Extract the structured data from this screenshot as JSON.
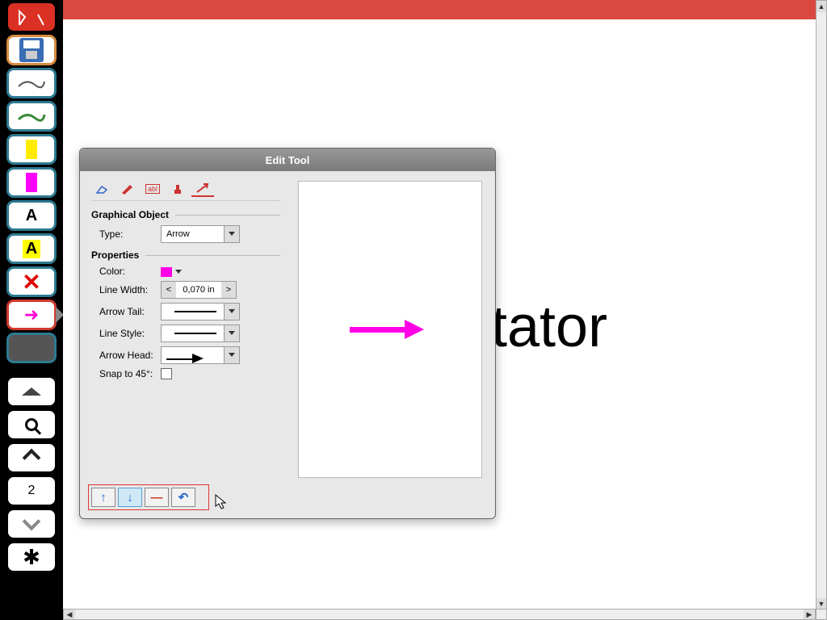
{
  "bg_text": "tator",
  "dialog": {
    "title": "Edit Tool",
    "section_object": "Graphical Object",
    "section_props": "Properties",
    "labels": {
      "type": "Type:",
      "color": "Color:",
      "line_width": "Line Width:",
      "arrow_tail": "Arrow Tail:",
      "line_style": "Line Style:",
      "arrow_head": "Arrow Head:",
      "snap": "Snap to 45°:"
    },
    "values": {
      "type": "Arrow",
      "line_width": "0,070 in",
      "color": "#ff00e6"
    },
    "spinner": {
      "dec": "<",
      "inc": ">"
    }
  },
  "page_number": "2"
}
